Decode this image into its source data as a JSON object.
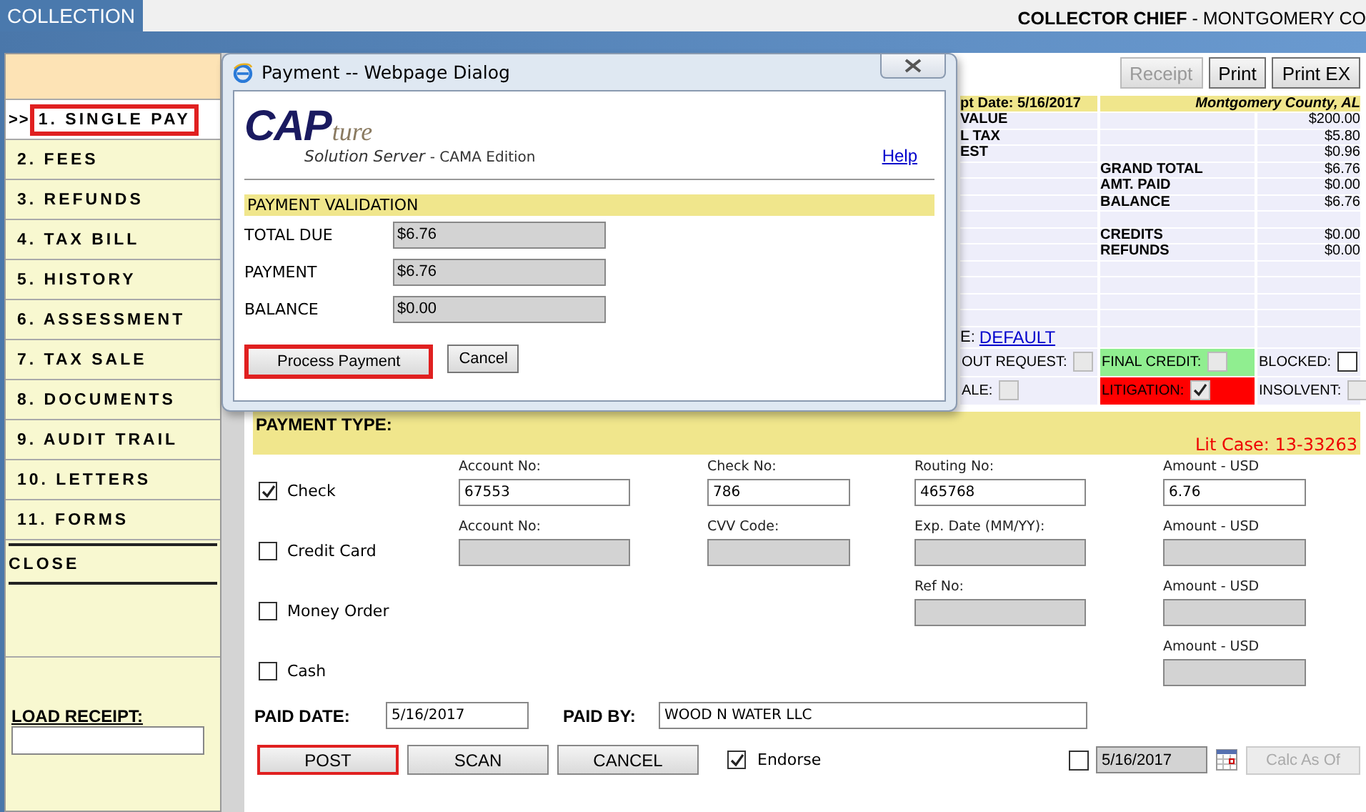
{
  "header": {
    "tab": "COLLECTION",
    "title": "**COLLECTOR CHIEF** - MONTGOMERY CO"
  },
  "sidebar": {
    "selected_marker": ">>",
    "items": [
      {
        "label": "1. SINGLE PAY",
        "selected": true
      },
      {
        "label": "2. FEES",
        "selected": false
      },
      {
        "label": "3. REFUNDS",
        "selected": false
      },
      {
        "label": "4. TAX BILL",
        "selected": false
      },
      {
        "label": "5. HISTORY",
        "selected": false
      },
      {
        "label": "6. ASSESSMENT",
        "selected": false
      },
      {
        "label": "7. TAX SALE",
        "selected": false
      },
      {
        "label": "8. DOCUMENTS",
        "selected": false
      },
      {
        "label": "9. AUDIT TRAIL",
        "selected": false
      },
      {
        "label": "10. LETTERS",
        "selected": false
      },
      {
        "label": "11. FORMS",
        "selected": false
      }
    ],
    "close": "CLOSE",
    "load_receipt": "LOAD RECEIPT:"
  },
  "toolbar": [
    {
      "label": "Receipt",
      "disabled": true
    },
    {
      "label": "Print",
      "disabled": false
    },
    {
      "label": "Print EX",
      "disabled": false
    }
  ],
  "summary": {
    "date_label": "pt Date: 5/16/2017",
    "county": "Montgomery County, AL",
    "rows": [
      {
        "c1": "VALUE",
        "c3": "$200.00"
      },
      {
        "c1": "L TAX",
        "c3": "$5.80"
      },
      {
        "c1": "EST",
        "c3": "$0.96"
      },
      {
        "c2": "GRAND TOTAL",
        "c3": "$6.76"
      },
      {
        "c2": "AMT. PAID",
        "c3": "$0.00"
      },
      {
        "c2": "BALANCE",
        "c3": "$6.76"
      },
      {},
      {
        "c2": "CREDITS",
        "c3": "$0.00"
      },
      {
        "c2": "REFUNDS",
        "c3": "$0.00"
      },
      {},
      {},
      {},
      {}
    ],
    "link_row": {
      "prefix": "E:",
      "link": "DEFAULT"
    },
    "flags": [
      [
        {
          "label": "OUT REQUEST:",
          "checked": false,
          "disabled": true
        },
        {
          "label": "FINAL CREDIT:",
          "checked": false,
          "disabled": true,
          "color": "#90ee90"
        },
        {
          "label": "BLOCKED:",
          "checked": false,
          "disabled": false
        }
      ],
      [
        {
          "label": "ALE:",
          "checked": false,
          "disabled": true
        },
        {
          "label": "LITIGATION:",
          "checked": true,
          "disabled": true,
          "color": "#ff0000"
        },
        {
          "label": "INSOLVENT:",
          "checked": false,
          "disabled": true
        }
      ]
    ]
  },
  "payment": {
    "title": "PAYMENT TYPE:",
    "lit_case": "Lit Case: 13-33263",
    "methods": [
      {
        "label": "Check",
        "checked": true,
        "fields": [
          {
            "kind": "account",
            "label": "Account No:",
            "value": "67553",
            "disabled": false
          },
          {
            "kind": "code",
            "label": "Check No:",
            "value": "786",
            "disabled": false
          },
          {
            "kind": "reference",
            "label": "Routing No:",
            "value": "465768",
            "disabled": false
          },
          {
            "kind": "amount",
            "label": "Amount - USD",
            "value": "6.76",
            "disabled": false
          }
        ]
      },
      {
        "label": "Credit Card",
        "checked": false,
        "fields": [
          {
            "kind": "account",
            "label": "Account No:",
            "disabled": true
          },
          {
            "kind": "code",
            "label": "CVV Code:",
            "disabled": true
          },
          {
            "kind": "reference",
            "label": "Exp. Date (MM/YY):",
            "disabled": true
          },
          {
            "kind": "amount",
            "label": "Amount - USD",
            "disabled": true
          }
        ]
      },
      {
        "label": "Money Order",
        "checked": false,
        "fields": [
          {
            "kind": "reference",
            "label": "Ref No:",
            "disabled": true
          },
          {
            "kind": "amount",
            "label": "Amount - USD",
            "disabled": true
          }
        ]
      },
      {
        "label": "Cash",
        "checked": false,
        "fields": [
          {
            "kind": "amount",
            "label": "Amount - USD",
            "disabled": true
          }
        ]
      }
    ],
    "paid_date": {
      "label": "PAID DATE:",
      "value": "5/16/2017"
    },
    "paid_by": {
      "label": "PAID BY:",
      "value": "WOOD N WATER LLC"
    },
    "actions": [
      {
        "label": "POST",
        "highlighted": true
      },
      {
        "label": "SCAN",
        "highlighted": false
      },
      {
        "label": "CANCEL",
        "highlighted": false
      }
    ],
    "endorse": {
      "label": "Endorse",
      "checked": true
    },
    "as_of": {
      "checked": false,
      "date": "5/16/2017",
      "button": "Calc As Of"
    }
  },
  "dialog": {
    "title": "Payment -- Webpage Dialog",
    "logo": {
      "main": "CAP",
      "script": "ture",
      "subtitle": "Solution Server",
      "edition": "- CAMA Edition"
    },
    "help": "Help",
    "section": "PAYMENT VALIDATION",
    "fields": [
      {
        "label": "TOTAL DUE",
        "value": "$6.76"
      },
      {
        "label": "PAYMENT",
        "value": "$6.76"
      },
      {
        "label": "BALANCE",
        "value": "$0.00"
      }
    ],
    "buttons": [
      {
        "label": "Process Payment",
        "highlighted": true
      },
      {
        "label": "Cancel",
        "highlighted": false
      }
    ]
  }
}
